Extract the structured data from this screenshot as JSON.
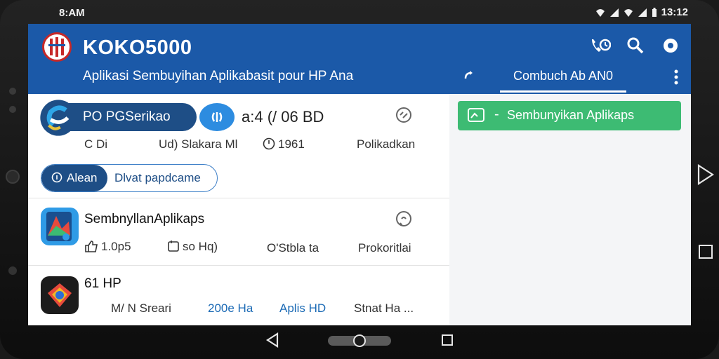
{
  "status_bar": {
    "time_left": "8:AM",
    "time_right": "13:12"
  },
  "app": {
    "title": "KOKO5000",
    "subtitle": "Aplikasi Sembuyihan Aplikabasit pour HP Ana",
    "tab_label": "Combuch Ab AN0"
  },
  "row1": {
    "pill_label": "PO PGSerikao",
    "headline": "a:4 (/ 06 BD",
    "meta": [
      "C Di",
      "Ud) Slakara Ml",
      "1961",
      "Polikadkan"
    ],
    "action_left": "Alean",
    "action_right": "Dlvat papdcame"
  },
  "row2": {
    "title": "SembnyllanAplikaps",
    "meta": [
      "1.0p5",
      "so Hq)",
      "O'Stbla ta",
      "Prokoritlai"
    ]
  },
  "row3": {
    "title": "61 HP",
    "meta": [
      "M/ N Sreari",
      "200e Ha",
      "Aplis HD",
      "Stnat Ha ..."
    ]
  },
  "right_panel": {
    "button_label": "Sembunyikan Aplikaps",
    "button_dash": "-"
  },
  "colors": {
    "appbar": "#1b59a8",
    "accent_green": "#3dbb73",
    "pill_dark": "#1e4e86",
    "link_blue": "#1b6ab5"
  },
  "icons": {
    "status": [
      "wifi-icon",
      "signal-icon",
      "battery-icon"
    ],
    "appbar": [
      "call-timer-icon",
      "search-icon",
      "settings-icon",
      "sync-icon",
      "overflow-icon"
    ],
    "nav": [
      "back-icon",
      "home-icon",
      "recents-icon"
    ]
  }
}
